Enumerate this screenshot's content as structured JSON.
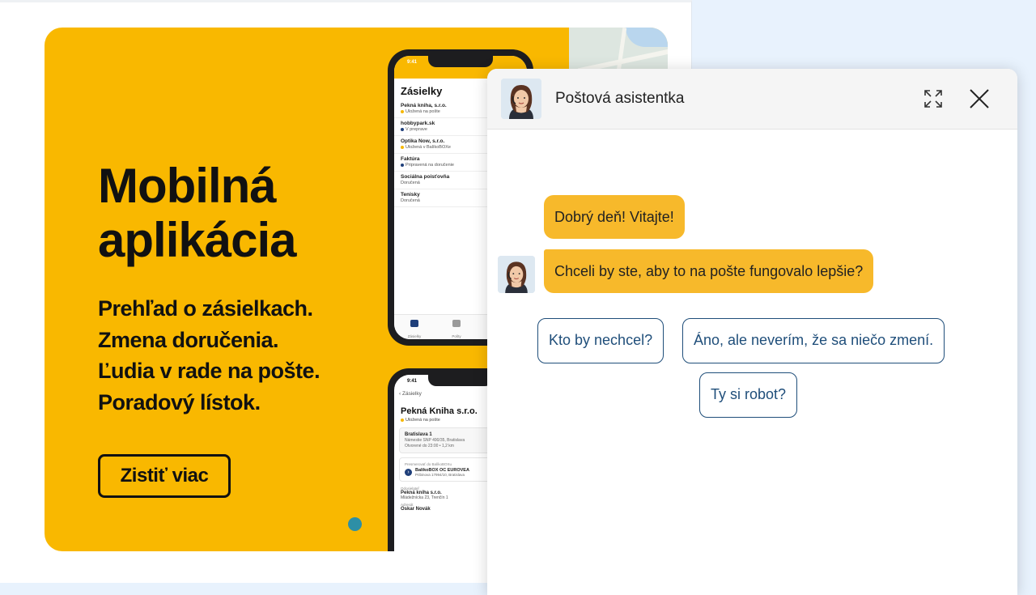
{
  "banner": {
    "title_line1": "Mobilná",
    "title_line2": "aplikácia",
    "features": [
      "Prehľad o zásielkach.",
      "Zmena doručenia.",
      "Ľudia v rade na pošte.",
      "Poradový lístok."
    ],
    "cta_label": "Zistiť viac",
    "background_color": "#f9b800",
    "carousel_dot_color": "#2d8fa6"
  },
  "phone1": {
    "status_time": "9:41",
    "app_title": "Zásielky",
    "items": [
      {
        "name": "Pekná kniha, s.r.o.",
        "status": "Uložená na pošte",
        "dot": "#f5b700"
      },
      {
        "name": "hobbypark.sk",
        "status": "V preprave",
        "dot": "#1f3f7a"
      },
      {
        "name": "Optika Now, s.r.o.",
        "status": "Uložená v BalíkoBOXe",
        "dot": "#f5b700"
      },
      {
        "name": "Faktúra",
        "status": "Pripravená na doručenie",
        "dot": "#1f3f7a"
      },
      {
        "name": "Sociálna poisťovňa",
        "status": "Doručená",
        "dot": ""
      },
      {
        "name": "Tenisky",
        "status": "Doručená",
        "dot": ""
      }
    ],
    "tabs": [
      "Zásielky",
      "Pošty"
    ]
  },
  "phone2": {
    "status_time": "9:41",
    "back_label": "Zásielky",
    "title": "Pekná Kniha s.r.o.",
    "status": "Uložená na pošte",
    "post_office_name": "Bratislava 1",
    "post_office_address": "Námestie SNP 490/35, Bratislava",
    "post_office_hours": "Otvorené do 23:00 • 1,2 km",
    "redirect_label": "Presmerovať do BalíkoBOXu",
    "redirect_name": "BalíkoBOX OC EUROVEA",
    "redirect_address": "Pribinova 17994/10, Bratislava",
    "sender_label": "Odosielateľ",
    "sender_name": "Pekná kniha s.r.o.",
    "sender_address": "Mládežnícka 23, Trenčín 1",
    "recipient_label": "Adresát",
    "recipient_name": "Oskar Novák"
  },
  "chat": {
    "title": "Poštová asistentka",
    "messages": [
      "Dobrý deň! Vitajte!",
      "Chceli by ste, aby to na pošte fungovalo lepšie?"
    ],
    "quick_replies": [
      "Kto by nechcel?",
      "Áno, ale neverím, že sa niečo zmení.",
      "Ty si robot?"
    ],
    "bubble_color": "#f7b92b",
    "reply_border_color": "#1f4e7a"
  }
}
